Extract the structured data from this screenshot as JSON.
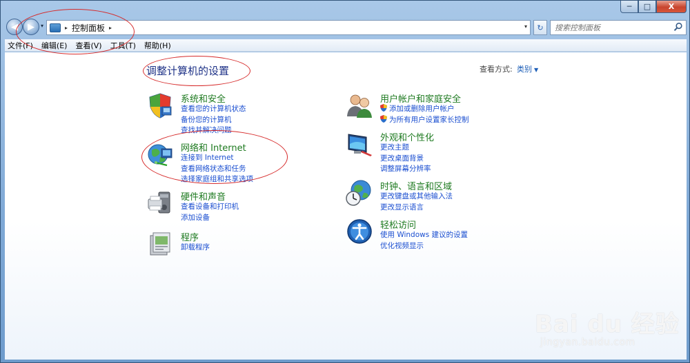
{
  "window": {
    "controls": {
      "minimize": "─",
      "maximize": "□",
      "close": "X"
    }
  },
  "navbar": {
    "back_glyph": "◀",
    "forward_glyph": "▶",
    "address_path": "控制面板",
    "separator": "▸",
    "dropdown": "▾",
    "refresh_glyph": "↻",
    "search_placeholder": "搜索控制面板"
  },
  "menu": {
    "items": [
      {
        "label": "文件(F)"
      },
      {
        "label": "编辑(E)"
      },
      {
        "label": "查看(V)"
      },
      {
        "label": "工具(T)"
      },
      {
        "label": "帮助(H)"
      }
    ]
  },
  "content": {
    "title": "调整计算机的设置",
    "view_by_label": "查看方式:",
    "view_by_value": "类别",
    "view_by_chevron": "▼"
  },
  "categories": {
    "system": {
      "icon": "shield-icon",
      "title": "系统和安全",
      "links": [
        "查看您的计算机状态",
        "备份您的计算机",
        "查找并解决问题"
      ]
    },
    "network": {
      "icon": "network-globe-icon",
      "title": "网络和 Internet",
      "links": [
        "连接到 Internet",
        "查看网络状态和任务",
        "选择家庭组和共享选项"
      ]
    },
    "hardware": {
      "icon": "printer-icon",
      "title": "硬件和声音",
      "links": [
        "查看设备和打印机",
        "添加设备"
      ]
    },
    "programs": {
      "icon": "programs-icon",
      "title": "程序",
      "links": [
        "卸载程序"
      ]
    },
    "users": {
      "icon": "users-icon",
      "title": "用户帐户和家庭安全",
      "links": [
        "添加或删除用户帐户",
        "为所有用户设置家长控制"
      ]
    },
    "appearance": {
      "icon": "monitor-icon",
      "title": "外观和个性化",
      "links": [
        "更改主题",
        "更改桌面背景",
        "调整屏幕分辨率"
      ]
    },
    "clock": {
      "icon": "clock-globe-icon",
      "title": "时钟、语言和区域",
      "links": [
        "更改键盘或其他输入法",
        "更改显示语言"
      ]
    },
    "ease": {
      "icon": "ease-of-access-icon",
      "title": "轻松访问",
      "links": [
        "使用 Windows 建议的设置",
        "优化视频显示"
      ]
    }
  },
  "watermark": {
    "text": "Bai du 经验",
    "url": "jingyan.baidu.com"
  },
  "colors": {
    "category_title": "#1e7a20",
    "link": "#1a4ed0",
    "page_title": "#1e3287",
    "annotation": "#d62a2a"
  }
}
